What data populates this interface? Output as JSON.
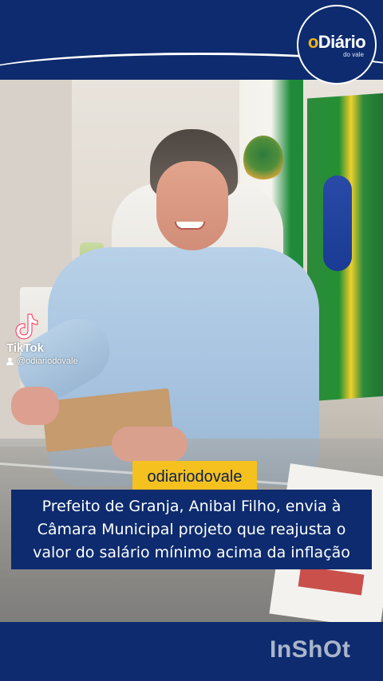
{
  "logo": {
    "brand_prefix": "o",
    "brand_name": "Diário",
    "brand_sub": "do vale"
  },
  "tiktok": {
    "icon": "tiktok-icon",
    "label": "TikTok",
    "user_icon": "user-icon",
    "username": "@odiariodovale"
  },
  "tag": {
    "text": "odiariodovale",
    "color": "#f4c11f"
  },
  "caption": {
    "lines": [
      "Prefeito de Granja, Anibal Filho, envia à",
      "Câmara Municipal projeto que reajusta o",
      "valor do salário mínimo acima da inflação"
    ],
    "background": "#0d2b6e"
  },
  "watermark": {
    "text": "InShOt"
  },
  "colors": {
    "brand_blue": "#0d2b6e",
    "accent_yellow": "#f4c11f"
  }
}
